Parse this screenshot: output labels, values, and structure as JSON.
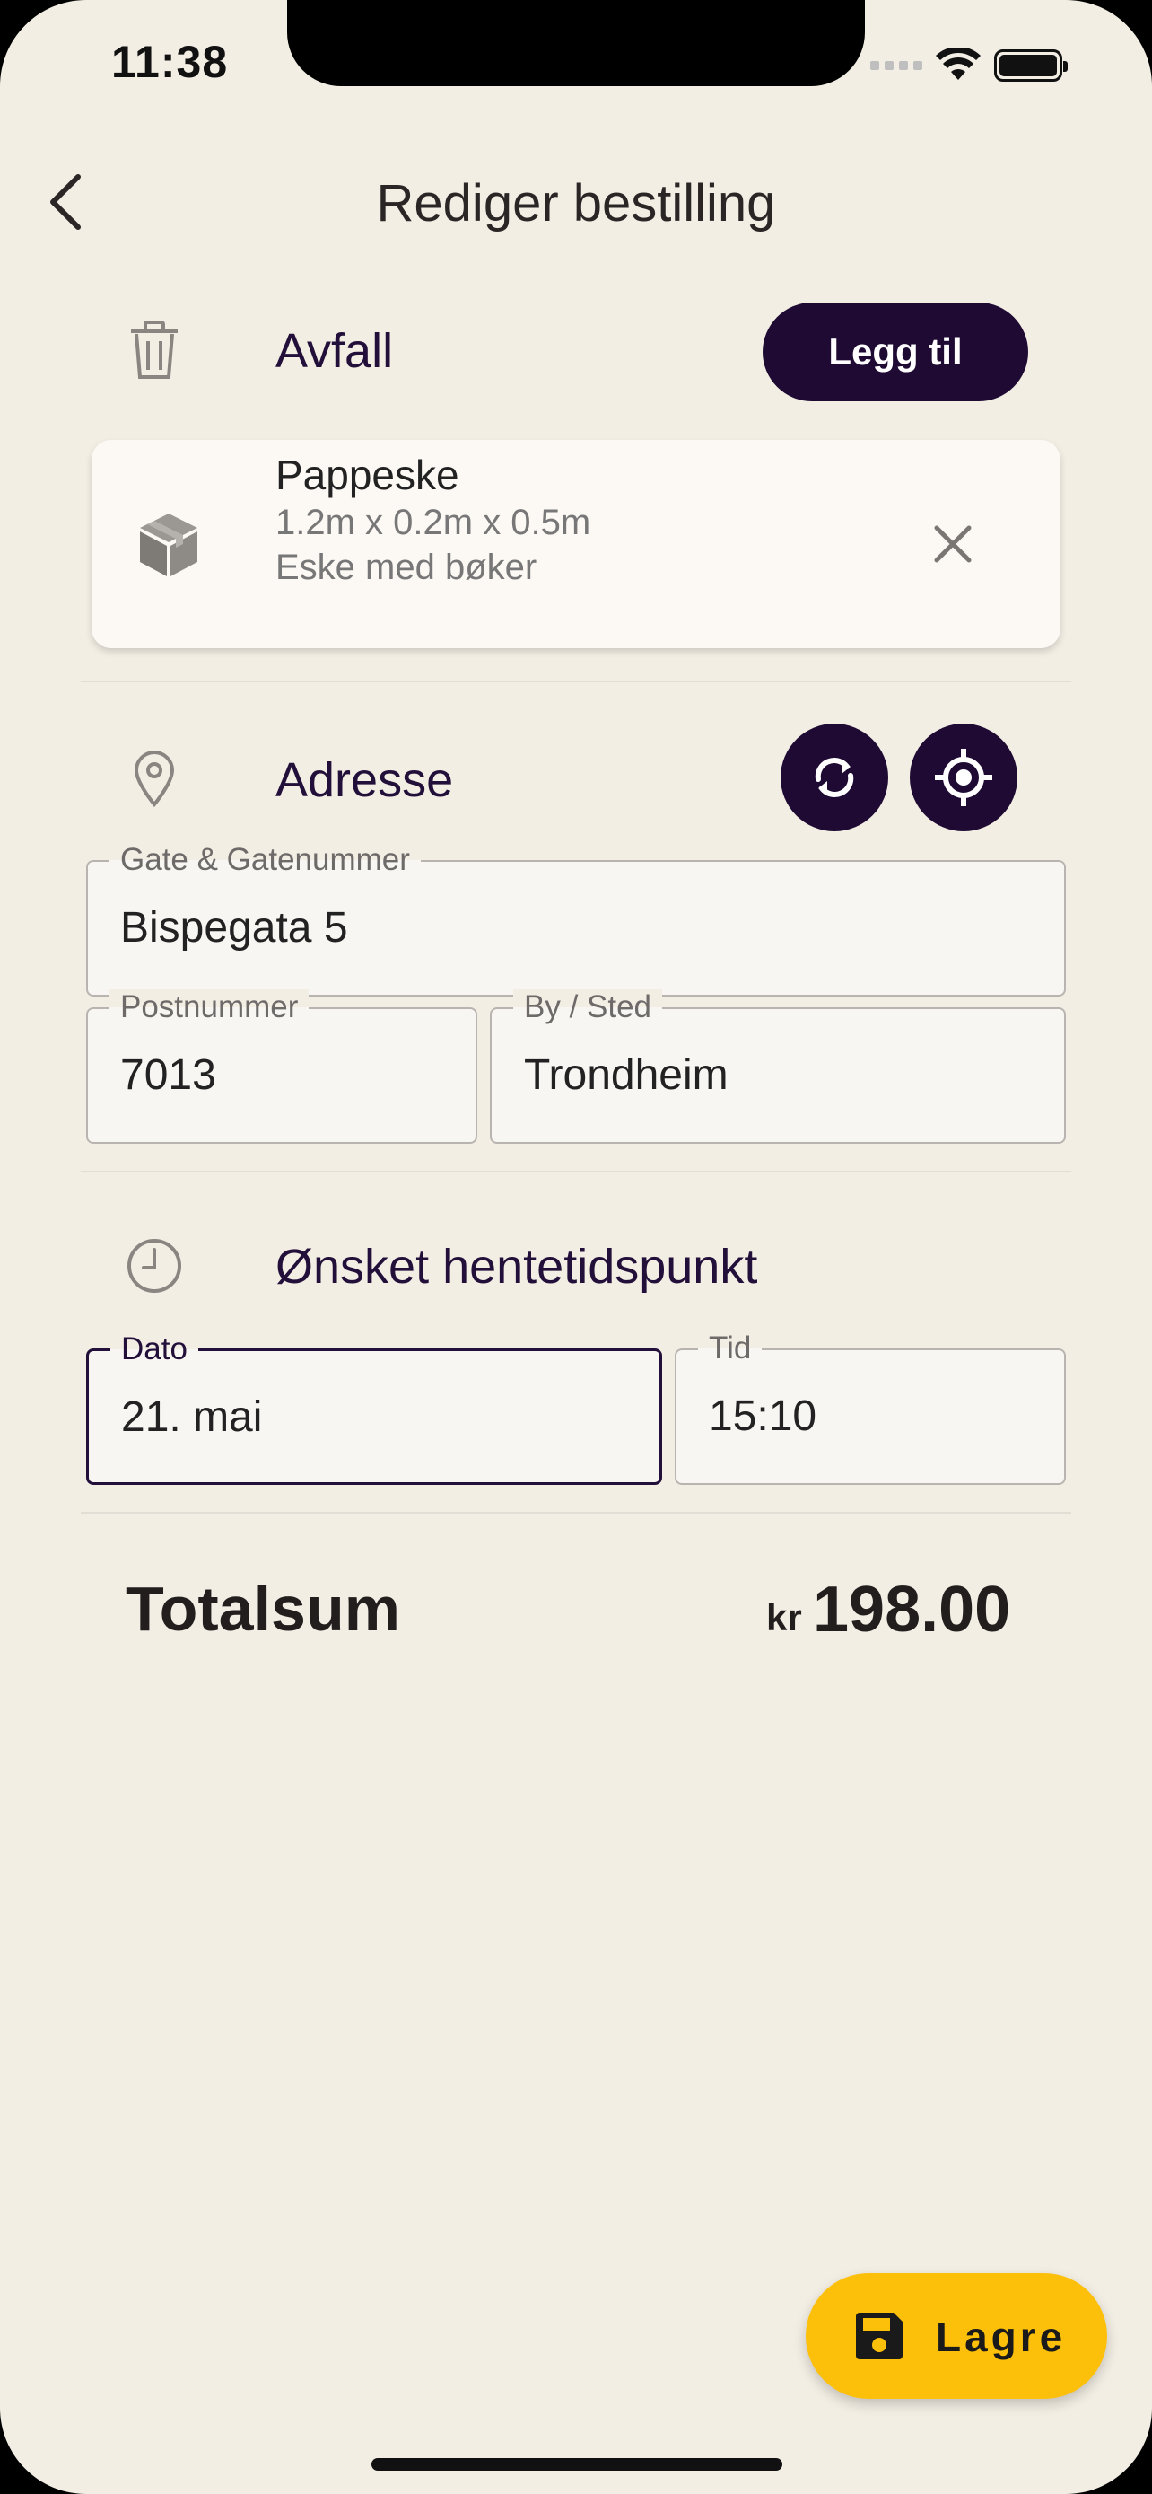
{
  "status_bar": {
    "time": "11:38"
  },
  "header": {
    "title": "Rediger bestilling"
  },
  "waste": {
    "section_title": "Avfall",
    "add_label": "Legg til",
    "items": [
      {
        "name": "Pappeske",
        "dimensions": "1.2m x 0.2m x 0.5m",
        "description": "Eske med bøker"
      }
    ]
  },
  "address": {
    "section_title": "Adresse",
    "street": {
      "label": "Gate & Gatenummer",
      "value": "Bispegata 5"
    },
    "postal": {
      "label": "Postnummer",
      "value": "7013"
    },
    "city": {
      "label": "By / Sted",
      "value": "Trondheim"
    }
  },
  "pickup": {
    "section_title": "Ønsket hentetidspunkt",
    "date": {
      "label": "Dato",
      "value": "21. mai"
    },
    "time": {
      "label": "Tid",
      "value": "15:10"
    }
  },
  "total": {
    "label": "Totalsum",
    "currency": "kr",
    "amount": "198.00"
  },
  "save": {
    "label": "Lagre"
  },
  "colors": {
    "primary": "#1E0A33",
    "accent": "#FCBF0A",
    "background": "#F2EEE4"
  },
  "icons": [
    "chevron-left-icon",
    "trash-icon",
    "box-icon",
    "close-icon",
    "map-pin-icon",
    "refresh-icon",
    "locate-icon",
    "clock-icon",
    "floppy-disk-icon"
  ]
}
